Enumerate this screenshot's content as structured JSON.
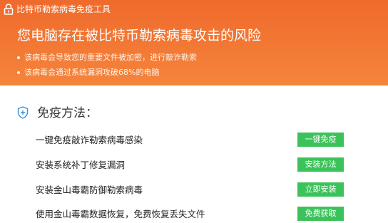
{
  "window": {
    "title": "比特币勒索病毒免疫工具"
  },
  "header": {
    "headline": "您电脑存在被比特币勒索病毒攻击的风险",
    "bullets": [
      "该病毒会导致您的重要文件被加密，进行敲诈勒索",
      "该病毒会通过系统漏洞攻破68%的电脑"
    ]
  },
  "section": {
    "title": "免疫方法："
  },
  "methods": [
    {
      "label": "一键免疫敲诈勒索病毒感染",
      "button": "一键免疫"
    },
    {
      "label": "安装系统补丁修复漏洞",
      "button": "安装方法"
    },
    {
      "label": "安装金山毒霸防御勒索病毒",
      "button": "立即安装"
    },
    {
      "label": "使用金山毒霸数据恢复，免费恢复丢失文件",
      "button": "免费获取"
    }
  ],
  "colors": {
    "header_orange": "#f37a35",
    "button_green": "#3cc25a",
    "shield_blue": "#3a8ed8"
  },
  "icons": {
    "app": "lock-icon",
    "section": "shield-plus-icon"
  }
}
